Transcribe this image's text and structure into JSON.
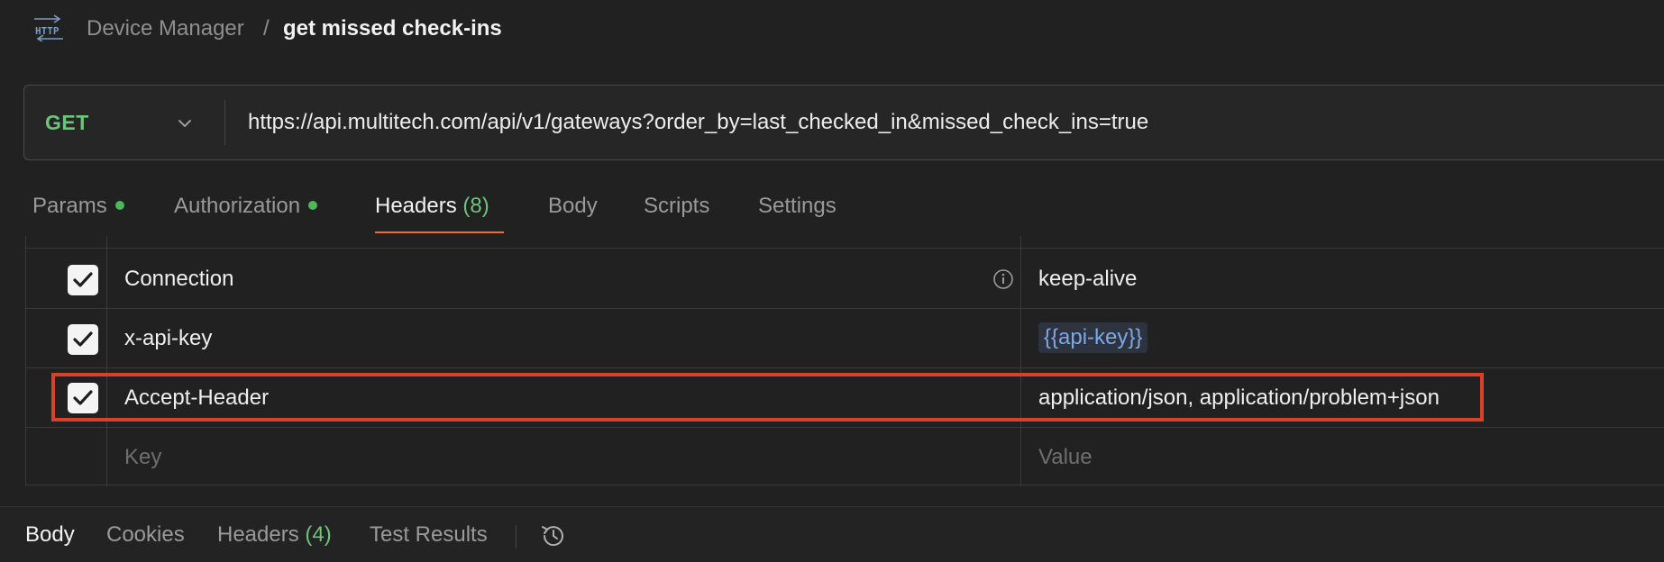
{
  "breadcrumb": {
    "icon": "http-icon",
    "parent": "Device Manager",
    "separator": "/",
    "current": "get missed check-ins"
  },
  "request": {
    "method": "GET",
    "url": "https://api.multitech.com/api/v1/gateways?order_by=last_checked_in&missed_check_ins=true"
  },
  "tabs": {
    "params": "Params",
    "authorization": "Authorization",
    "headers": "Headers",
    "headers_count": "(8)",
    "body": "Body",
    "scripts": "Scripts",
    "settings": "Settings",
    "active": "Headers"
  },
  "headers_table": {
    "rows": [
      {
        "checked": true,
        "key": "Connection",
        "value": "keep-alive",
        "has_info_icon": true
      },
      {
        "checked": true,
        "key": "x-api-key",
        "value": "{{api-key}}",
        "is_variable": true
      },
      {
        "checked": true,
        "key": "Accept-Header",
        "value": "application/json, application/problem+json",
        "highlighted": true
      }
    ],
    "placeholder_key": "Key",
    "placeholder_value": "Value"
  },
  "response_tabs": {
    "body": "Body",
    "cookies": "Cookies",
    "headers": "Headers",
    "headers_count": "(4)",
    "test_results": "Test Results",
    "history_icon": "history-icon"
  },
  "colors": {
    "method": "#6cc57a",
    "active_tab_underline": "#f06b3c",
    "status_dot": "#4cb85a",
    "variable": "#7ea7e6",
    "highlight": "#d9412b"
  }
}
